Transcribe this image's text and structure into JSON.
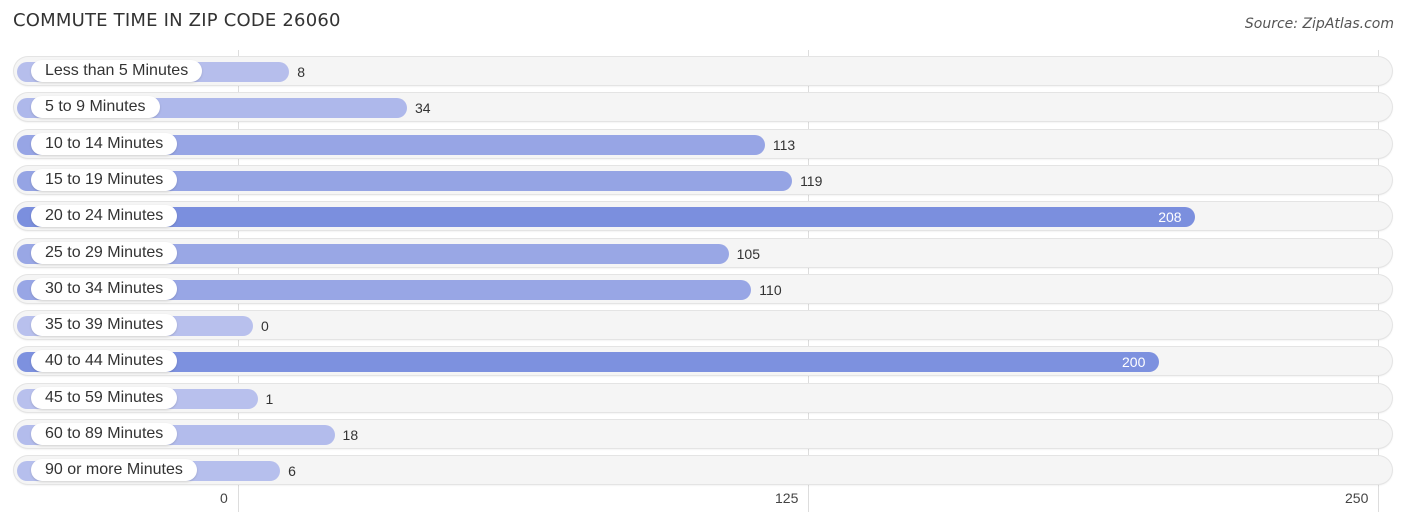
{
  "title": "COMMUTE TIME IN ZIP CODE 26060",
  "source": "Source: ZipAtlas.com",
  "chart_data": {
    "type": "bar",
    "orientation": "horizontal",
    "title": "COMMUTE TIME IN ZIP CODE 26060",
    "xlabel": "",
    "ylabel": "",
    "xlim": [
      0,
      250
    ],
    "ticks": [
      "0",
      "125",
      "250"
    ],
    "tick_values": [
      0,
      125,
      250
    ],
    "grid": true,
    "categories": [
      "Less than 5 Minutes",
      "5 to 9 Minutes",
      "10 to 14 Minutes",
      "15 to 19 Minutes",
      "20 to 24 Minutes",
      "25 to 29 Minutes",
      "30 to 34 Minutes",
      "35 to 39 Minutes",
      "40 to 44 Minutes",
      "45 to 59 Minutes",
      "60 to 89 Minutes",
      "90 or more Minutes"
    ],
    "values": [
      8,
      34,
      113,
      119,
      208,
      105,
      110,
      0,
      200,
      1,
      18,
      6
    ],
    "colors": {
      "low": "#b8c0ed",
      "high": "#7b8fde"
    }
  }
}
